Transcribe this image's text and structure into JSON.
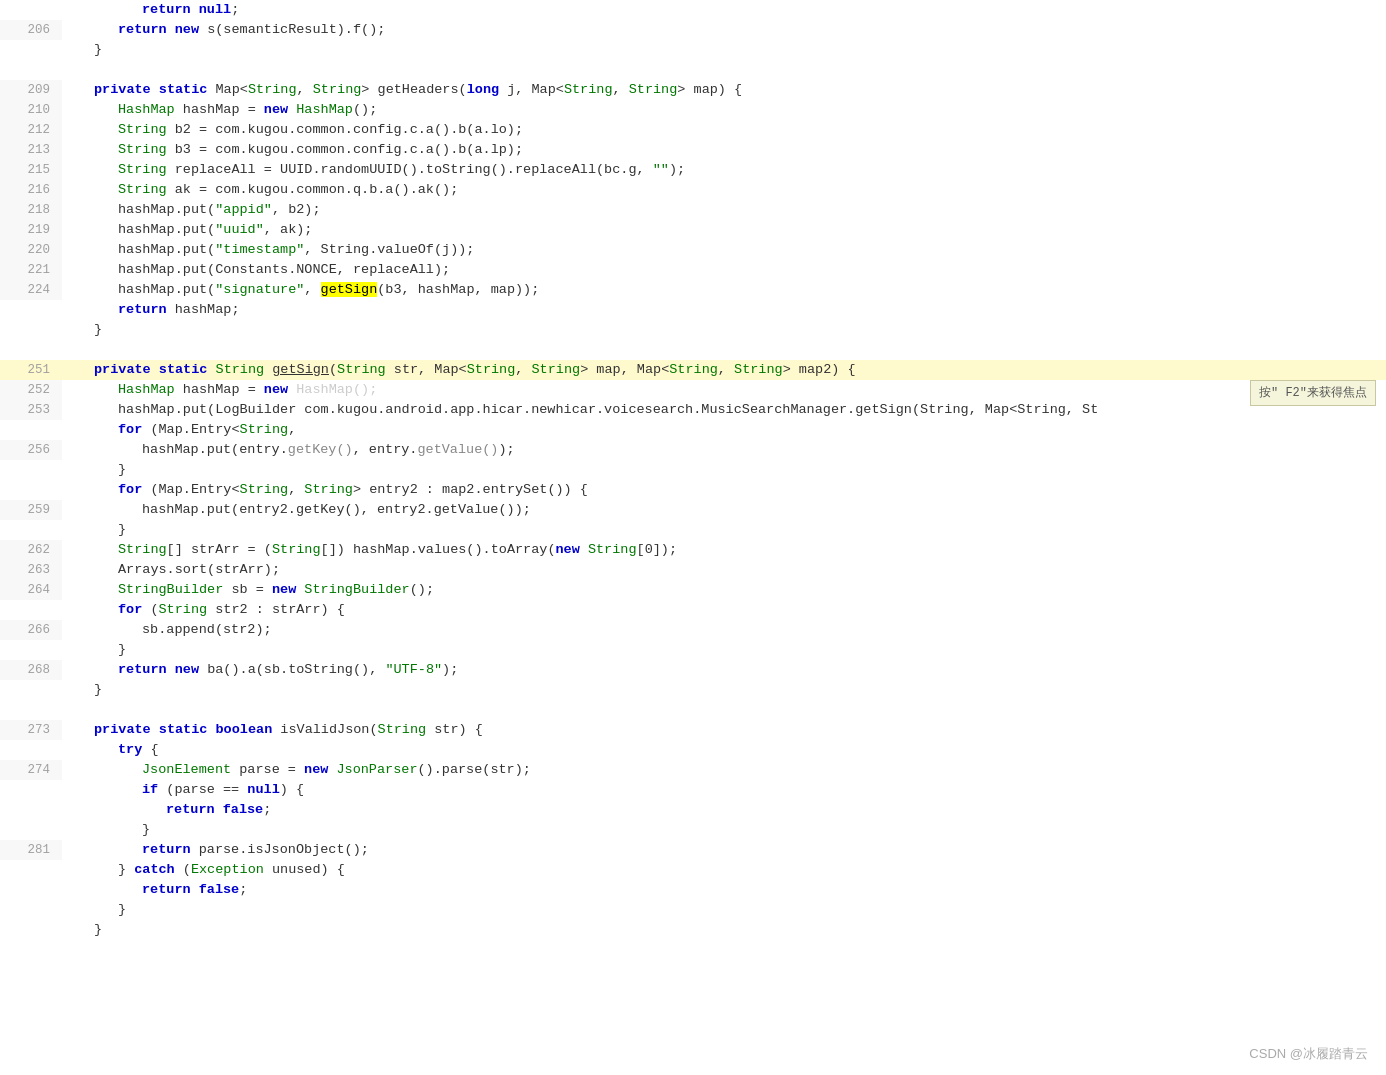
{
  "watermark": "CSDN @冰履踏青云",
  "tooltip": "按\" F2\"来获得焦点",
  "lines": [
    {
      "num": "",
      "content": "return null;",
      "indent": 3,
      "type": "normal",
      "blank": false
    },
    {
      "num": "206",
      "content": "return_new_s_semanticResult_f",
      "indent": 2,
      "type": "normal",
      "blank": false
    },
    {
      "num": "",
      "content": "}",
      "indent": 1,
      "type": "normal",
      "blank": false
    },
    {
      "num": "",
      "blank": true
    },
    {
      "num": "209",
      "content": "private_static_map_getHeaders",
      "indent": 1,
      "type": "normal",
      "blank": false
    },
    {
      "num": "210",
      "content": "HashMap_hashMap_new_HashMap",
      "indent": 2,
      "type": "normal",
      "blank": false
    },
    {
      "num": "212",
      "content": "String_b2_com_kugou_config_a_b_lo",
      "indent": 2,
      "type": "normal",
      "blank": false
    },
    {
      "num": "213",
      "content": "String_b3_com_kugou_config_a_b_lp",
      "indent": 2,
      "type": "normal",
      "blank": false
    },
    {
      "num": "215",
      "content": "String_replaceAll_UUID_random",
      "indent": 2,
      "type": "normal",
      "blank": false
    },
    {
      "num": "216",
      "content": "String_ak_com_kugou_common_q_b_a_ak",
      "indent": 2,
      "type": "normal",
      "blank": false
    },
    {
      "num": "218",
      "content": "hashMap_put_appid_b2",
      "indent": 2,
      "type": "normal",
      "blank": false
    },
    {
      "num": "219",
      "content": "hashMap_put_uuid_ak",
      "indent": 2,
      "type": "normal",
      "blank": false
    },
    {
      "num": "220",
      "content": "hashMap_put_timestamp_String_valueOf_j",
      "indent": 2,
      "type": "normal",
      "blank": false
    },
    {
      "num": "221",
      "content": "hashMap_put_Constants_NONCE_replaceAll",
      "indent": 2,
      "type": "normal",
      "blank": false
    },
    {
      "num": "224",
      "content": "hashMap_put_signature_getSign_b3_hashMap_map",
      "indent": 2,
      "type": "normal",
      "blank": false
    },
    {
      "num": "",
      "content": "return hashMap;",
      "indent": 2,
      "type": "normal",
      "blank": false
    },
    {
      "num": "",
      "content": "}",
      "indent": 1,
      "type": "normal",
      "blank": false
    },
    {
      "num": "",
      "blank": true
    },
    {
      "num": "251",
      "content": "private_static_String_getSign_highlighted",
      "indent": 1,
      "type": "highlighted",
      "blank": false
    },
    {
      "num": "252",
      "content": "HashMap_hashMap_new_HashMap_truncated",
      "indent": 2,
      "type": "normal",
      "blank": false
    },
    {
      "num": "253",
      "content": "hashMap_put_LogBuilder_truncated",
      "indent": 2,
      "type": "normal",
      "blank": false
    },
    {
      "num": "",
      "content": "for_Map_Entry_String_truncated",
      "indent": 2,
      "type": "normal",
      "blank": false
    },
    {
      "num": "256",
      "content": "hashMap_put_entry_getKey_entry_getValue",
      "indent": 3,
      "type": "normal",
      "blank": false
    },
    {
      "num": "",
      "content": "}",
      "indent": 2,
      "type": "normal",
      "blank": false
    },
    {
      "num": "",
      "content": "for_Map_Entry_String_String_entry2_map2_entrySet",
      "indent": 2,
      "type": "normal",
      "blank": false
    },
    {
      "num": "259",
      "content": "hashMap_put_entry2_getKey_entry2_getValue",
      "indent": 3,
      "type": "normal",
      "blank": false
    },
    {
      "num": "",
      "content": "}",
      "indent": 2,
      "type": "normal",
      "blank": false
    },
    {
      "num": "262",
      "content": "String_arr_strArr_HashMap_values_toArray_new_String_0",
      "indent": 2,
      "type": "normal",
      "blank": false
    },
    {
      "num": "263",
      "content": "Arrays_sort_strArr",
      "indent": 2,
      "type": "normal",
      "blank": false
    },
    {
      "num": "264",
      "content": "StringBuilder_sb_new_StringBuilder",
      "indent": 2,
      "type": "normal",
      "blank": false
    },
    {
      "num": "",
      "content": "for_String_str2_strArr",
      "indent": 2,
      "type": "normal",
      "blank": false
    },
    {
      "num": "266",
      "content": "sb_append_str2",
      "indent": 3,
      "type": "normal",
      "blank": false
    },
    {
      "num": "",
      "content": "}",
      "indent": 2,
      "type": "normal",
      "blank": false
    },
    {
      "num": "268",
      "content": "return_new_ba_a_sb_toString_UTF8",
      "indent": 2,
      "type": "normal",
      "blank": false
    },
    {
      "num": "",
      "content": "}",
      "indent": 1,
      "type": "normal",
      "blank": false
    },
    {
      "num": "",
      "blank": true
    },
    {
      "num": "273",
      "content": "private_static_boolean_isValidJson_String_str",
      "indent": 1,
      "type": "normal",
      "blank": false
    },
    {
      "num": "",
      "content": "try_open",
      "indent": 2,
      "type": "normal",
      "blank": false
    },
    {
      "num": "274",
      "content": "JsonElement_parse_new_JsonParser_parse_str",
      "indent": 3,
      "type": "normal",
      "blank": false
    },
    {
      "num": "",
      "content": "if_parse_eq_null_open",
      "indent": 3,
      "type": "normal",
      "blank": false
    },
    {
      "num": "",
      "content": "return_false_inner",
      "indent": 4,
      "type": "normal",
      "blank": false
    },
    {
      "num": "",
      "content": "close_if",
      "indent": 3,
      "type": "normal",
      "blank": false
    },
    {
      "num": "281",
      "content": "return_parse_isJsonObject",
      "indent": 3,
      "type": "normal",
      "blank": false
    },
    {
      "num": "",
      "content": "catch_Exception_unused_open",
      "indent": 2,
      "type": "normal",
      "blank": false
    },
    {
      "num": "",
      "content": "return_false_catch",
      "indent": 3,
      "type": "normal",
      "blank": false
    },
    {
      "num": "",
      "content": "close_catch",
      "indent": 2,
      "type": "normal",
      "blank": false
    },
    {
      "num": "",
      "content": "close_method",
      "indent": 1,
      "type": "normal",
      "blank": false
    }
  ]
}
